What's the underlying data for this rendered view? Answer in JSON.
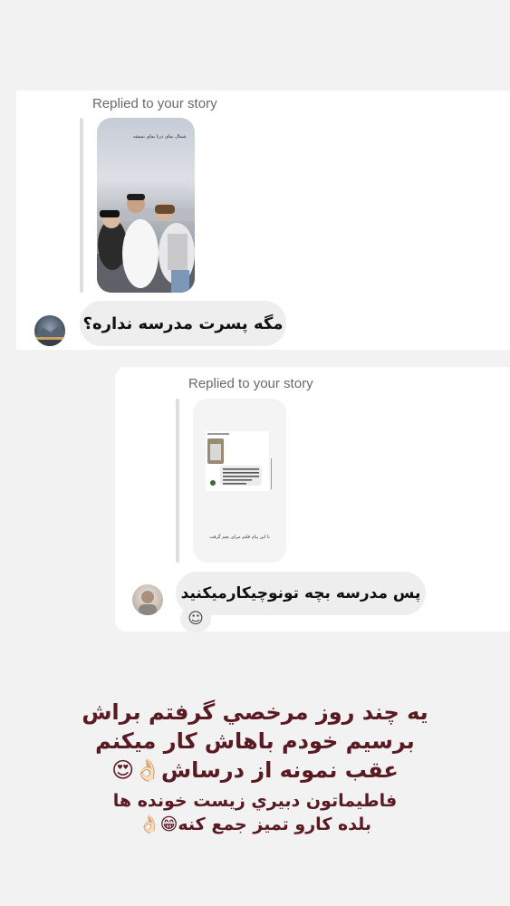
{
  "messages": [
    {
      "replied_label": "Replied to your story",
      "story_overlay_text": "شمال بمای دریا بمای نمیشه",
      "text": "مگه پسرت مدرسه نداره؟"
    },
    {
      "replied_label": "Replied to your story",
      "story_caption": "با این پیام قلبم مرای بچم گرفت",
      "text": "پس مدرسه بچه تونوچیکارمیکنید",
      "react_icon": "add-reaction-icon"
    }
  ],
  "caption": {
    "line1": "یه چند روز مرخصي گرفتم براش",
    "line2": "برسیم خودم باهاش کار میکنم",
    "line3": "عقب نمونه از درساش👌🏻😍",
    "line4": "فاطیماتون دبیري زیست خونده ها",
    "line5": "بلده کارو تمیز جمع کنه😁👌🏻"
  }
}
